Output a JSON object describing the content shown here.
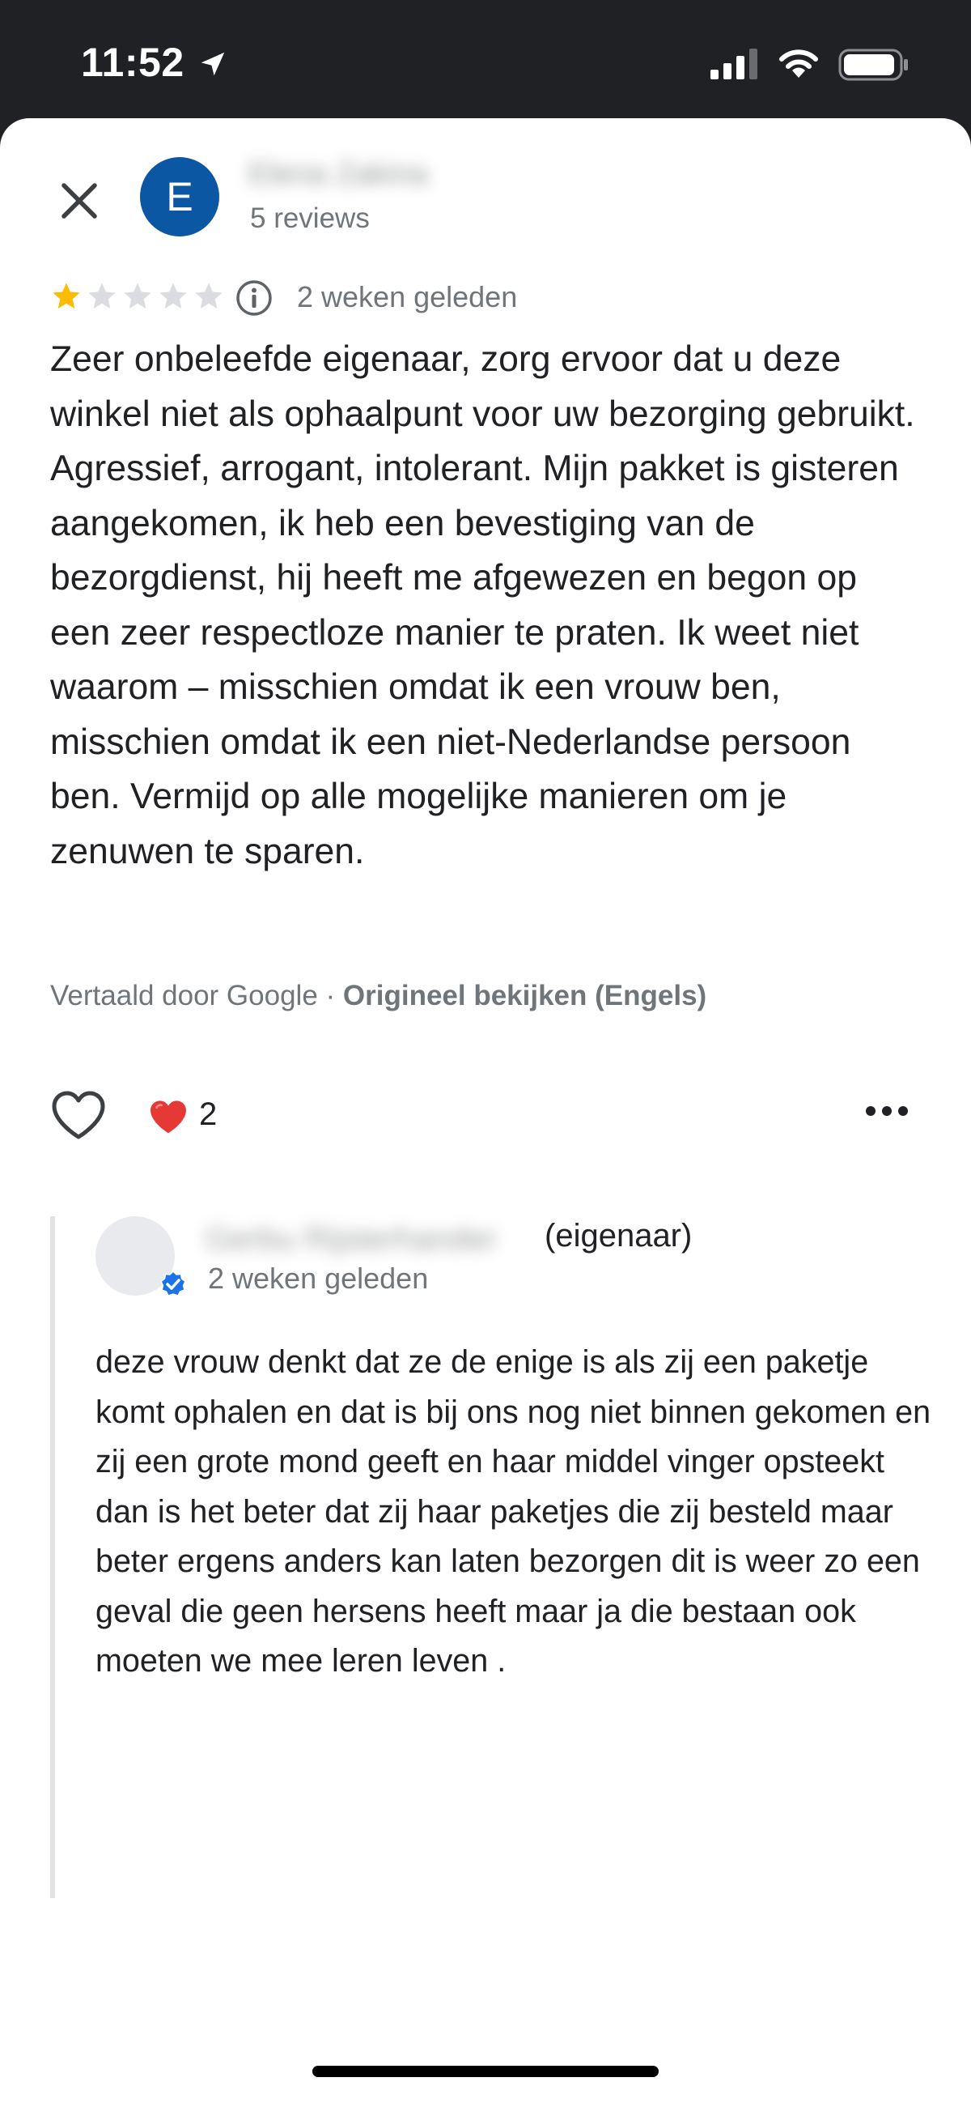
{
  "status_bar": {
    "time": "11:52"
  },
  "review": {
    "avatar_letter": "E",
    "reviewer_name": "Elena Zakina",
    "review_count": "5 reviews",
    "rating": 1,
    "rating_max": 5,
    "date": "2 weken geleden",
    "text": "Zeer onbeleefde eigenaar, zorg ervoor dat u deze winkel niet als ophaalpunt voor uw bezorging gebruikt. Agressief, arrogant, intolerant. Mijn pakket is gisteren aangekomen, ik heb een bevestiging van de bezorgdienst, hij heeft me afgewezen en begon op een zeer respectloze manier te praten. Ik weet niet waarom – misschien omdat ik een vrouw ben, misschien omdat ik een niet-Nederlandse persoon ben. Vermijd op alle mogelijke manieren om je zenuwen te sparen.",
    "translated_by": "Vertaald door Google · ",
    "view_original": "Origineel bekijken (Engels)",
    "reaction_count": "2"
  },
  "reply": {
    "owner_name": "Gerbu Rijsterhander",
    "owner_tag": "(eigenaar)",
    "date": "2 weken geleden",
    "text": "deze vrouw denkt dat ze de enige is als zij een paketje komt ophalen en dat is bij ons nog niet binnen gekomen en zij een grote mond geeft en haar middel vinger opsteekt dan is het beter dat zij haar paketjes die zij besteld maar beter ergens anders kan laten bezorgen dit is weer zo een geval die geen hersens heeft maar ja die bestaan ook moeten we mee leren leven ."
  },
  "colors": {
    "star_filled": "#fbbc04",
    "star_empty": "#dadce0",
    "avatar_bg": "#0b57a4",
    "verified": "#1a73e8"
  },
  "icons": [
    "location-arrow-icon",
    "signal-icon",
    "wifi-icon",
    "battery-icon",
    "close-icon",
    "star-icon",
    "info-icon",
    "heart-outline-icon",
    "heart-filled-icon",
    "more-icon",
    "verified-icon"
  ]
}
